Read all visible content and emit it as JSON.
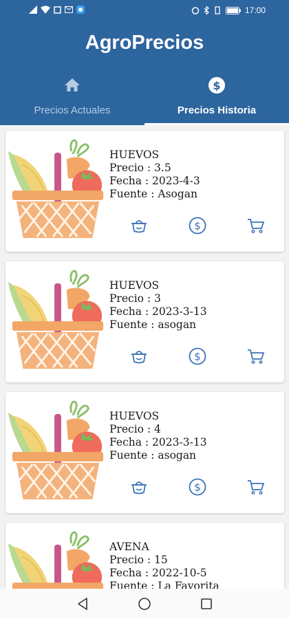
{
  "status_bar": {
    "time": "17:00"
  },
  "app": {
    "title": "AgroPrecios"
  },
  "tabs": [
    {
      "label": "Precios Actuales",
      "icon": "home-icon",
      "active": false
    },
    {
      "label": "Precios Historia",
      "icon": "dollar-circle-icon",
      "active": true
    }
  ],
  "colors": {
    "primary": "#2d659e",
    "icon_blue": "#3b73b8",
    "inactive_tab": "#b7cce3"
  },
  "items": [
    {
      "name": "HUEVOS",
      "precio": "Precio : 3.5",
      "fecha": "Fecha : 2023-4-3",
      "fuente": "Fuente : Asogan"
    },
    {
      "name": "HUEVOS",
      "precio": "Precio : 3",
      "fecha": "Fecha : 2023-3-13",
      "fuente": "Fuente : asogan"
    },
    {
      "name": "HUEVOS",
      "precio": "Precio : 4",
      "fecha": "Fecha : 2023-3-13",
      "fuente": "Fuente : asogan"
    },
    {
      "name": "AVENA",
      "precio": "Precio : 15",
      "fecha": "Fecha : 2022-10-5",
      "fuente": "Fuente : La Favorita"
    }
  ],
  "card_actions": [
    "basket-icon",
    "dollar-circle-icon",
    "cart-icon"
  ],
  "nav": [
    "back-icon",
    "home-circle-icon",
    "recents-icon"
  ]
}
